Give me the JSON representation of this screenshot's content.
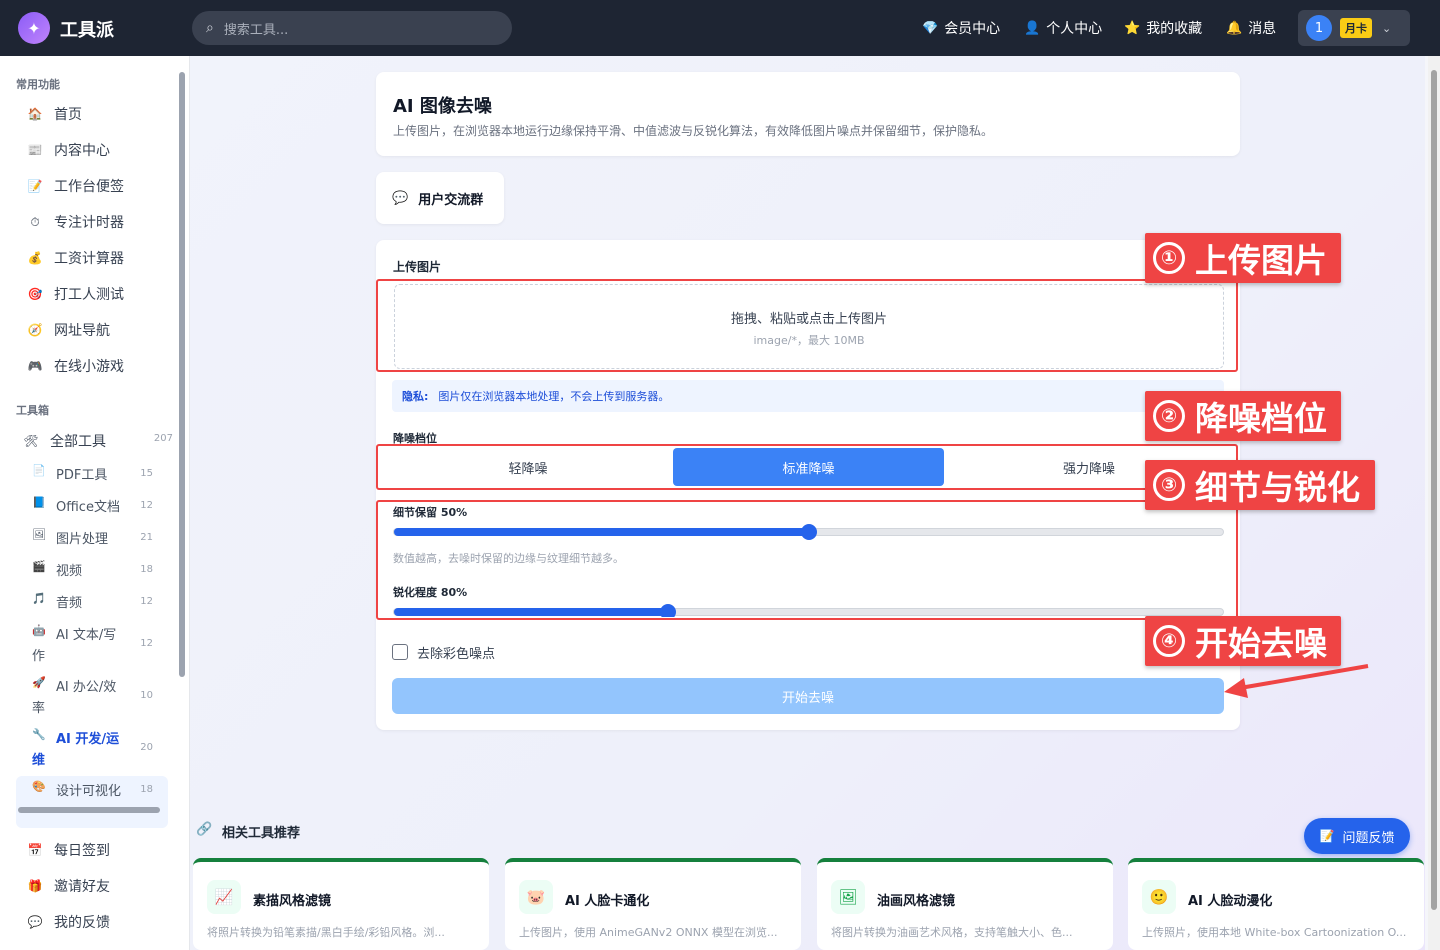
{
  "header": {
    "brand": "工具派",
    "search_placeholder": "搜索工具...",
    "nav": [
      {
        "label": "会员中心",
        "icon": "diamond-icon",
        "glyph": "💎"
      },
      {
        "label": "个人中心",
        "icon": "user-icon",
        "glyph": "👤"
      },
      {
        "label": "我的收藏",
        "icon": "star-icon",
        "glyph": "⭐"
      },
      {
        "label": "消息",
        "icon": "bell-icon",
        "glyph": "🔔"
      }
    ],
    "user_number": "1",
    "plan_badge": "月卡"
  },
  "sidebar": {
    "common_title": "常用功能",
    "common_items": [
      {
        "label": "首页",
        "glyph": "🏠"
      },
      {
        "label": "内容中心",
        "glyph": "📰"
      },
      {
        "label": "工作台便签",
        "glyph": "📝"
      },
      {
        "label": "专注计时器",
        "glyph": "⏱"
      },
      {
        "label": "工资计算器",
        "glyph": "💰"
      },
      {
        "label": "打工人测试",
        "glyph": "🎯"
      },
      {
        "label": "网址导航",
        "glyph": "🧭"
      },
      {
        "label": "在线小游戏",
        "glyph": "🎮"
      }
    ],
    "toolbox_title": "工具箱",
    "all_tools": {
      "label": "全部工具",
      "count": "207",
      "glyph": "🛠"
    },
    "categories": [
      {
        "label": "PDF工具",
        "count": "15",
        "glyph": "📄"
      },
      {
        "label": "Office文档",
        "count": "12",
        "glyph": "📘"
      },
      {
        "label": "图片处理",
        "count": "21",
        "glyph": "🖼"
      },
      {
        "label": "视频",
        "count": "18",
        "glyph": "🎬"
      },
      {
        "label": "音频",
        "count": "12",
        "glyph": "🎵"
      },
      {
        "label_1": "AI 文本/写",
        "label_2": "作",
        "count": "12",
        "glyph": "🤖"
      },
      {
        "label_1": "AI 办公/效",
        "label_2": "率",
        "count": "10",
        "glyph": "🚀"
      },
      {
        "label_1": "AI 开发/运",
        "label_2": "维",
        "count": "20",
        "glyph": "🔧"
      },
      {
        "label": "设计可视化",
        "count": "18",
        "glyph": "🎨"
      }
    ],
    "bottom_items": [
      {
        "label": "每日签到",
        "glyph": "📅"
      },
      {
        "label": "邀请好友",
        "glyph": "🎁"
      },
      {
        "label": "我的反馈",
        "glyph": "💬"
      }
    ]
  },
  "page": {
    "title": "AI 图像去噪",
    "description": "上传图片，在浏览器本地运行边缘保持平滑、中值滤波与反锐化算法，有效降低图片噪点并保留细节，保护隐私。",
    "group_button": "用户交流群"
  },
  "tool": {
    "upload_label": "上传图片",
    "upload_main": "拖拽、粘贴或点击上传图片",
    "upload_sub": "image/*，最大 10MB",
    "privacy_label": "隐私:",
    "privacy_text": "图片仅在浏览器本地处理，不会上传到服务器。",
    "level_label": "降噪档位",
    "levels": [
      "轻降噪",
      "标准降噪",
      "强力降噪"
    ],
    "selected_level": "标准降噪",
    "detail_label": "细节保留 50%",
    "detail_value": 0.5,
    "detail_hint": "数值越高，去噪时保留的边缘与纹理细节越多。",
    "sharpen_label": "锐化程度 80%",
    "sharpen_value": 0.8,
    "color_noise_label": "去除彩色噪点",
    "color_noise_checked": false,
    "start_button": "开始去噪"
  },
  "annotations": [
    {
      "num": "①",
      "text": "上传图片"
    },
    {
      "num": "②",
      "text": "降噪档位"
    },
    {
      "num": "③",
      "text": "细节与锐化"
    },
    {
      "num": "④",
      "text": "开始去噪"
    }
  ],
  "related": {
    "title": "相关工具推荐",
    "items": [
      {
        "name": "素描风格滤镜",
        "desc": "将照片转换为铅笔素描/黑白手绘/彩铅风格。浏...",
        "glyph": "📈"
      },
      {
        "name": "AI 人脸卡通化",
        "desc": "上传图片，使用 AnimeGANv2 ONNX 模型在浏览...",
        "glyph": "🐷"
      },
      {
        "name": "油画风格滤镜",
        "desc": "将图片转换为油画艺术风格，支持笔触大小、色...",
        "glyph": "🖼"
      },
      {
        "name": "AI 人脸动漫化",
        "desc": "上传照片，使用本地 White-box Cartoonization O...",
        "glyph": "🙂"
      }
    ]
  },
  "feedback_button": "问题反馈",
  "colors": {
    "accent": "#3b82f6",
    "topbar": "#1e2533",
    "annotation": "#ef4444"
  }
}
